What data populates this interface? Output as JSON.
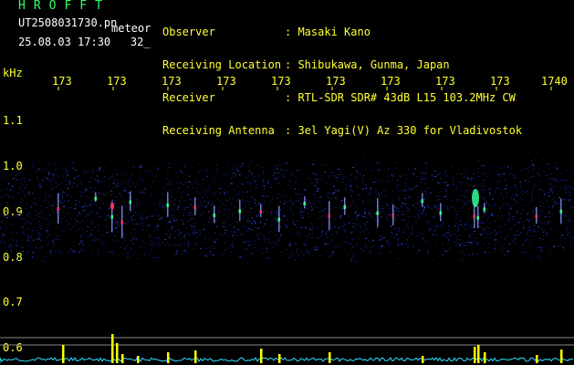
{
  "brand": "HROFFT",
  "file_name": "UT2508031730.pn",
  "mode_label": "meteor",
  "date_time": "25.08.03 17:30",
  "count": "32_",
  "header": {
    "labels": [
      "Observer",
      "Receiving Location",
      "Receiver",
      "Receiving Antenna"
    ],
    "values": [
      ": Masaki Kano",
      ": Shibukawa, Gunma, Japan",
      ": RTL-SDR SDR# 43dB L15 103.2MHz CW",
      ": 3el Yagi(V) Az 330 for Vladivostok"
    ]
  },
  "axis": {
    "unit": "kHz",
    "x_ticks": [
      "173",
      "173",
      "173",
      "173",
      "173",
      "173",
      "173",
      "173",
      "173",
      "1740"
    ],
    "y_ticks": [
      "1.1",
      "1.0",
      "0.9",
      "0.8",
      "0.7",
      "0.6"
    ]
  },
  "colors": {
    "text_primary": "#ffff33",
    "text_secondary": "#ffffff",
    "brand": "#33ff66",
    "background": "#000000",
    "band_noise": "#1a2a9a",
    "echo_hot": "#ff3366",
    "echo_warm": "#33ff99",
    "power_trace": "#33ddff",
    "power_spike": "#ffff00"
  }
}
